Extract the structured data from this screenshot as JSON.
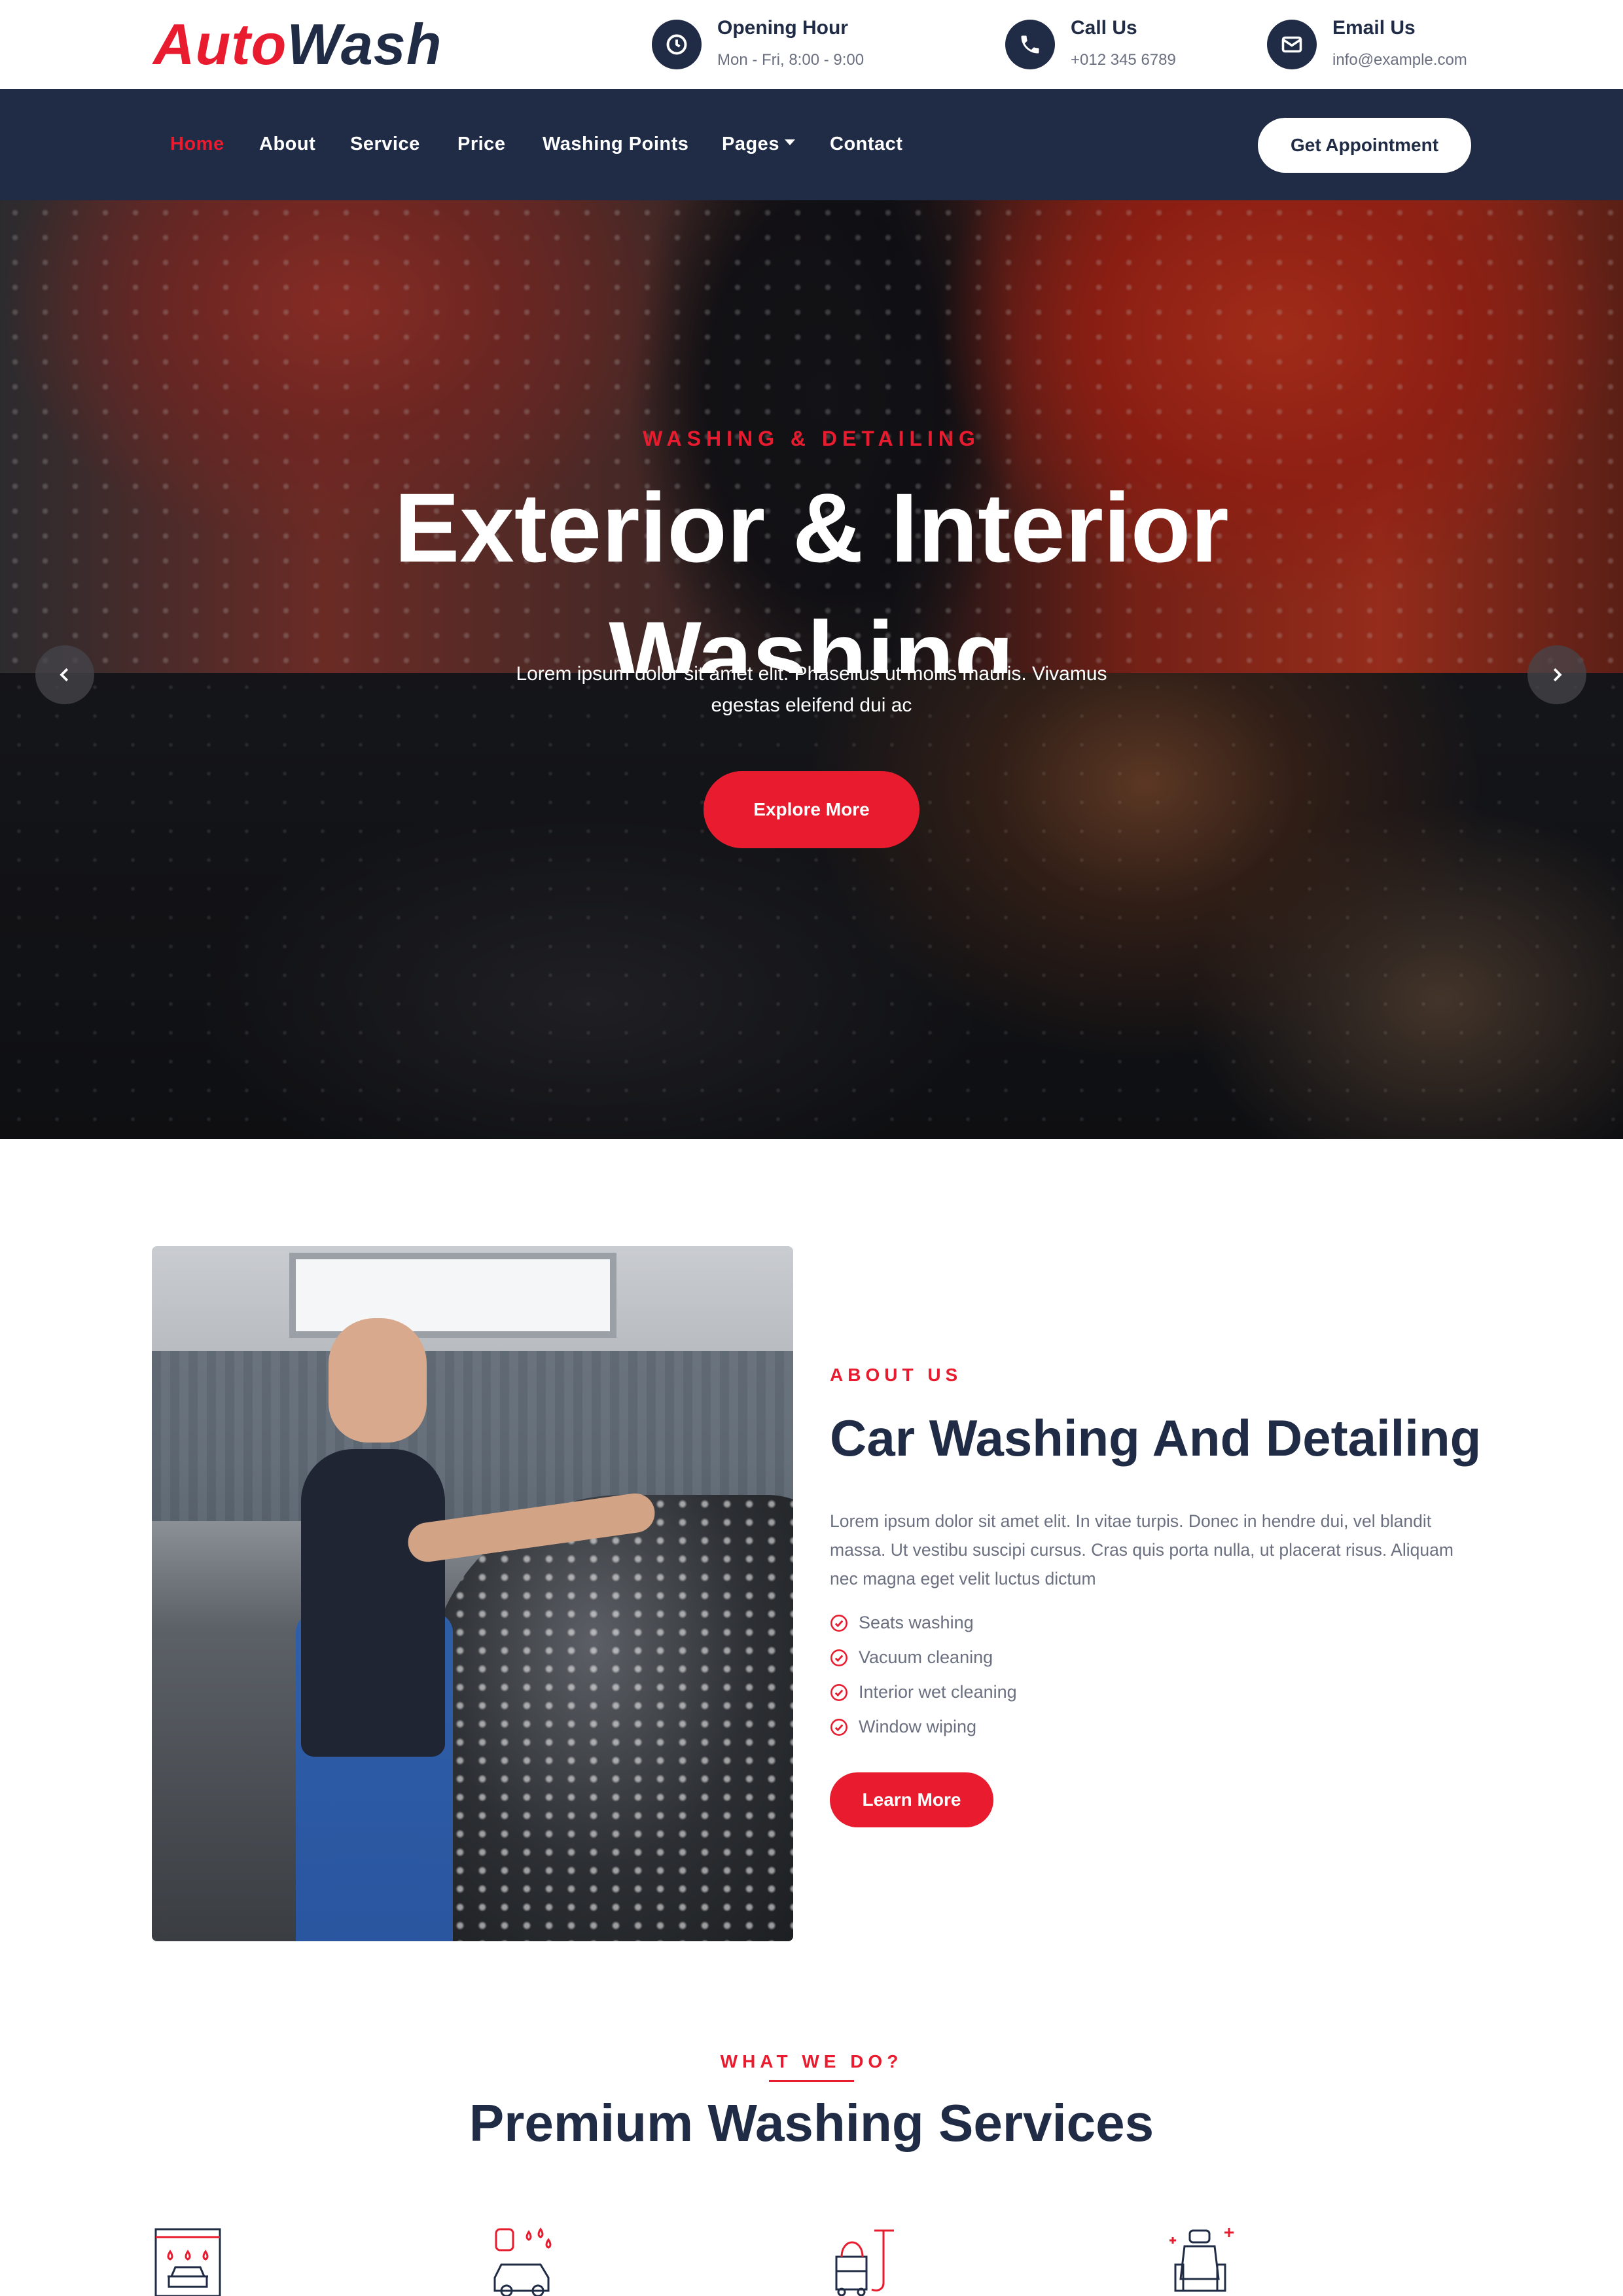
{
  "brand": {
    "part1": "Auto",
    "part2": "Wash"
  },
  "topbar": {
    "opening": {
      "title": "Opening Hour",
      "value": "Mon - Fri, 8:00 - 9:00",
      "icon": "clock-icon"
    },
    "call": {
      "title": "Call Us",
      "value": "+012 345 6789",
      "icon": "phone-icon"
    },
    "email": {
      "title": "Email Us",
      "value": "info@example.com",
      "icon": "envelope-icon"
    }
  },
  "nav": {
    "items": [
      "Home",
      "About",
      "Service",
      "Price",
      "Washing Points",
      "Pages",
      "Contact"
    ],
    "active": "Home",
    "cta": "Get Appointment"
  },
  "hero": {
    "eyebrow": "WASHING & DETAILING",
    "title": "Exterior & Interior Washing",
    "description": "Lorem ipsum dolor sit amet elit. Phasellus ut mollis mauris. Vivamus egestas eleifend dui ac",
    "button": "Explore More"
  },
  "about": {
    "eyebrow": "ABOUT US",
    "title": "Car Washing And Detailing",
    "text": "Lorem ipsum dolor sit amet elit. In vitae turpis. Donec in hendre dui, vel blandit massa. Ut vestibu suscipi cursus. Cras quis porta nulla, ut placerat risus. Aliquam nec magna eget velit luctus dictum",
    "features": [
      "Seats washing",
      "Vacuum cleaning",
      "Interior wet cleaning",
      "Window wiping"
    ],
    "button": "Learn More"
  },
  "services": {
    "eyebrow": "WHAT WE DO?",
    "title": "Premium Washing Services",
    "icons": [
      "car-wash-icon",
      "car-washing-icon",
      "vacuum-cleaner-icon",
      "car-seat-icon"
    ]
  },
  "colors": {
    "accent": "#e81c2e",
    "navy": "#202c45",
    "text_muted": "#6b7080"
  }
}
